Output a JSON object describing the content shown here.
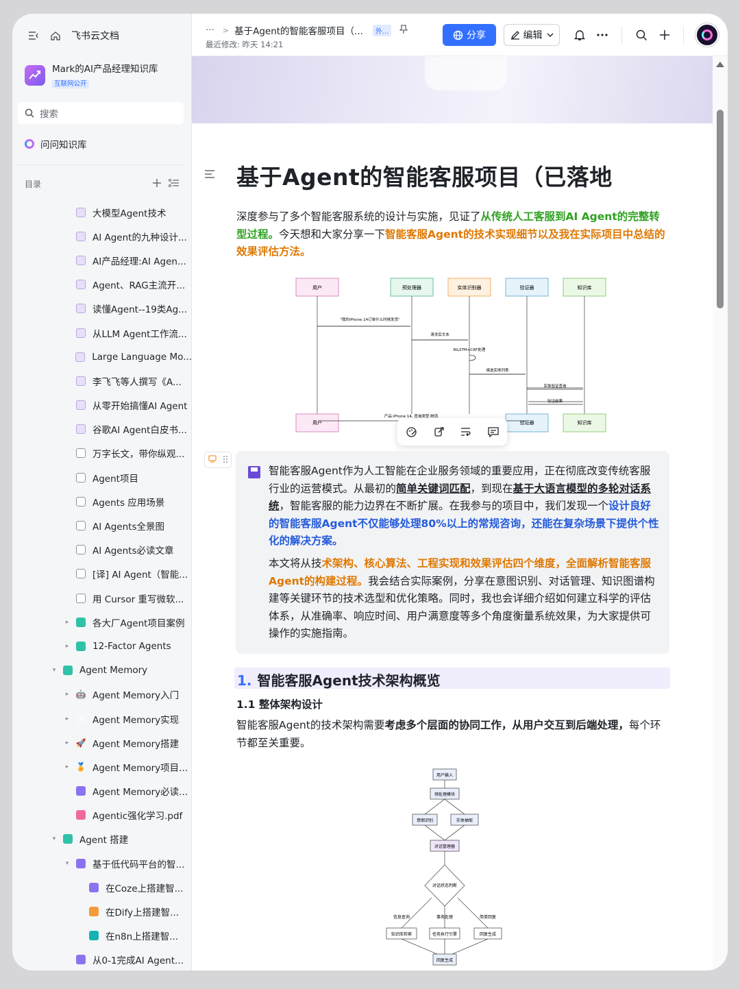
{
  "app": {
    "name": "飞书云文档"
  },
  "knowledge_base": {
    "name": "Mark的AI产品经理知识库",
    "badge": "互联网公开"
  },
  "search": {
    "placeholder": "搜索"
  },
  "ask": {
    "label": "问问知识库"
  },
  "toc": {
    "label": "目录"
  },
  "tree": [
    {
      "label": "大模型Agent技术",
      "icon": "page",
      "indent": 1
    },
    {
      "label": "AI Agent的九种设计...",
      "icon": "page",
      "indent": 1
    },
    {
      "label": "AI产品经理:AI Agen...",
      "icon": "page",
      "indent": 1
    },
    {
      "label": "Agent、RAG主流开...",
      "icon": "page",
      "indent": 1
    },
    {
      "label": "读懂Agent--19类Ag...",
      "icon": "page",
      "indent": 1
    },
    {
      "label": "从LLM Agent工作流...",
      "icon": "page",
      "indent": 1
    },
    {
      "label": "Large Language Mo...",
      "icon": "page",
      "indent": 1
    },
    {
      "label": "李飞飞等人撰写《A...",
      "icon": "page",
      "indent": 1
    },
    {
      "label": "从零开始搞懂AI Agent",
      "icon": "page",
      "indent": 1
    },
    {
      "label": "谷歌AI Agent白皮书...",
      "icon": "page",
      "indent": 1
    },
    {
      "label": "万字长文，带你纵观...",
      "icon": "doc",
      "indent": 1
    },
    {
      "label": "Agent项目",
      "icon": "mind",
      "indent": 1
    },
    {
      "label": "Agents 应用场景",
      "icon": "mind",
      "indent": 1
    },
    {
      "label": "AI Agents全景图",
      "icon": "mind",
      "indent": 1
    },
    {
      "label": "AI Agents必读文章",
      "icon": "mind",
      "indent": 1
    },
    {
      "label": "[译] AI Agent（智能...",
      "icon": "doc",
      "indent": 1
    },
    {
      "label": "用 Cursor 重写微软...",
      "icon": "doc",
      "indent": 1
    },
    {
      "label": "各大厂Agent项目案例",
      "icon": "green",
      "indent": 1,
      "arrow": "▸"
    },
    {
      "label": "12-Factor Agents",
      "icon": "green",
      "indent": 1,
      "arrow": "▸"
    },
    {
      "label": "Agent Memory",
      "icon": "green",
      "indent": 0,
      "arrow": "▾"
    },
    {
      "label": "Agent Memory入门",
      "icon": "emoji",
      "glyph": "🤖",
      "indent": 1,
      "arrow": "▸"
    },
    {
      "label": "Agent Memory实现",
      "icon": "emoji",
      "glyph": "🛠",
      "indent": 1,
      "arrow": "▸"
    },
    {
      "label": "Agent Memory搭建",
      "icon": "emoji",
      "glyph": "🚀",
      "indent": 1,
      "arrow": "▸"
    },
    {
      "label": "Agent Memory项目...",
      "icon": "emoji",
      "glyph": "🏅",
      "indent": 1,
      "arrow": "▸"
    },
    {
      "label": "Agent Memory必读...",
      "icon": "purple",
      "indent": 1
    },
    {
      "label": "Agentic强化学习.pdf",
      "icon": "pink",
      "indent": 1
    },
    {
      "label": "Agent 搭建",
      "icon": "green",
      "indent": 0,
      "arrow": "▾"
    },
    {
      "label": "基于低代码平台的智...",
      "icon": "purple",
      "indent": 1,
      "arrow": "▾"
    },
    {
      "label": "在Coze上搭建智...",
      "icon": "purple",
      "indent": 2
    },
    {
      "label": "在Dify上搭建智...",
      "icon": "orange",
      "indent": 2
    },
    {
      "label": "在n8n上搭建智...",
      "icon": "teal",
      "indent": 2
    },
    {
      "label": "从0-1完成AI Agent...",
      "icon": "purple",
      "indent": 1
    }
  ],
  "topbar": {
    "more": "···",
    "breadcrumb_title": "基于Agent的智能客服项目（...",
    "tag": "外...",
    "modified": "最近修改: 昨天 14:21",
    "share_label": "分享",
    "edit_label": "编辑"
  },
  "doc": {
    "title": "基于Agent的智能客服项目（已落地",
    "intro_1": "深度参与了多个智能客服系统的设计与实施，见证了",
    "intro_2": "从传统人工客服到AI Agent的完整转型过程。",
    "intro_3": "今天想和大家分享一下",
    "intro_4": "智能客服Agent的技术实现细节以及我在实际项目中总结的效果评估方法。",
    "callout_p1_a": "智能客服Agent作为人工智能在企业服务领域的重要应用，正在彻底改变传统客服行业的运营模式。从最初的",
    "callout_p1_b": "简单关键词匹配",
    "callout_p1_c": "，到现在",
    "callout_p1_d": "基于大语言模型的多轮对话系统",
    "callout_p1_e": "，智能客服的能力边界在不断扩展。在我参与的项目中，我们发现一个",
    "callout_p1_f": "设计良好的智能客服Agent不仅能够处理80%以上的常规咨询，还能在复杂场景下提供个性化的解决方案。",
    "callout_p2_a": "本文将从技",
    "callout_p2_b": "术架构、核心算法、工程实现和效果评估四个维度，全面解析智能客服Agent的构建过程。",
    "callout_p2_c": "我会结合实际案例，分享在意图识别、对话管理、知识图谱构建等关键环节的技术选型和优化策略。同时，我也会详细介绍如何建立科学的评估体系，从准确率、响应时间、用户满意度等多个角度衡量系统效果，为大家提供可操作的实施指南。",
    "h2_num": "1.",
    "h2": "智能客服Agent技术架构概览",
    "h3": "1.1 整体架构设计",
    "body_a": "智能客服Agent的技术架构需要",
    "body_b": "考虑多个层面的协同工作，从用户交互到后端处理，",
    "body_c": "每个环节都至关重要。"
  },
  "seq_diagram": {
    "actors": [
      "用户",
      "预处理器",
      "实体识别器",
      "验证器",
      "知识库"
    ],
    "messages": [
      "\"我的iPhone 14订单什么时候发货\"",
      "清洗后文本",
      "BiLSTM+CRF处理",
      "候选实体列表",
      "实体验证查询",
      "验证结果",
      "产品:iPhone 14, 查询类型:物流"
    ]
  },
  "flow_diagram": {
    "nodes": [
      "用户输入",
      "预处理模块",
      "意图识别",
      "实体抽取",
      "对话管理器",
      "对话状态判断",
      "知识库检索",
      "任务执行引擎",
      "回复生成",
      "回复生成"
    ],
    "edge_labels": [
      "信息查询",
      "事务处理",
      "简单回复"
    ]
  },
  "colors": {
    "accent": "#3370ff",
    "green": "#2ea121",
    "orange": "#de7802",
    "blue": "#245bdb"
  }
}
